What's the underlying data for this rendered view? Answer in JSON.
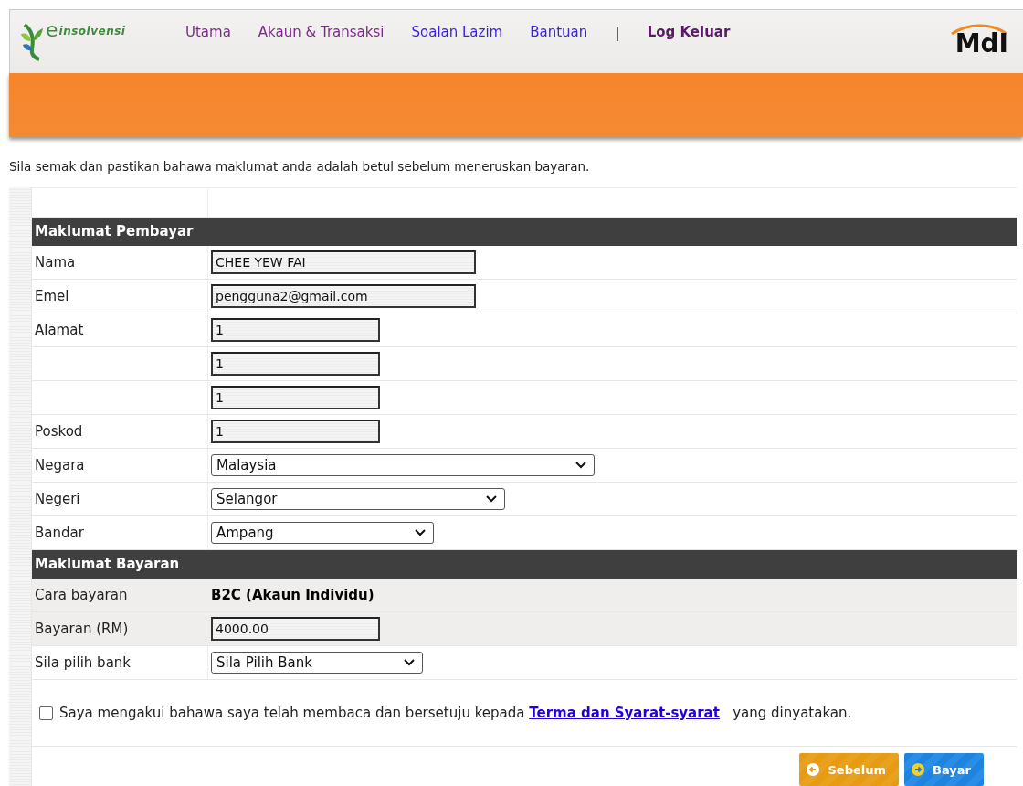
{
  "header": {
    "logo": {
      "letter": "e",
      "name": "insolvensi"
    },
    "nav": [
      {
        "label": "Utama",
        "color": "#7a2a8a",
        "bold": false
      },
      {
        "label": "Akaun & Transaksi",
        "color": "#7a2a8a",
        "bold": false
      },
      {
        "label": "Soalan Lazim",
        "color": "#3a22e0",
        "bold": false
      },
      {
        "label": "Bantuan",
        "color": "#3a22e0",
        "bold": false
      },
      {
        "label": "|",
        "kind": "separator"
      },
      {
        "label": "Log Keluar",
        "color": "#5a1a6a",
        "bold": true
      }
    ],
    "brand": "MdI"
  },
  "intro": "Sila semak dan pastikan bahawa maklumat anda adalah betul sebelum meneruskan bayaran.",
  "sections": [
    {
      "title": "Maklumat Pembayar",
      "rows": [
        {
          "label": "Nama",
          "kind": "input",
          "value": "CHEE YEW FAI",
          "shaded": false
        },
        {
          "label": "Emel",
          "kind": "input",
          "value": "pengguna2@gmail.com",
          "shaded": false
        },
        {
          "label": "Alamat",
          "kind": "input",
          "value": "1",
          "shaded": false
        },
        {
          "kind": "input",
          "value": "1",
          "shaded": false
        },
        {
          "kind": "input",
          "value": "1",
          "shaded": false
        },
        {
          "label": "Poskod",
          "kind": "input",
          "value": "1",
          "shaded": false
        },
        {
          "label": "Negara",
          "kind": "select",
          "value": "Malaysia",
          "shaded": false
        },
        {
          "label": "Negeri",
          "kind": "select",
          "value": "Selangor",
          "shaded": false
        },
        {
          "label": "Bandar",
          "kind": "select",
          "value": "Ampang",
          "shaded": false
        }
      ]
    },
    {
      "title": "Maklumat Bayaran",
      "rows": [
        {
          "label": "Cara bayaran",
          "kind": "text",
          "value": "B2C (Akaun Individu)",
          "shaded": true
        },
        {
          "label": "Bayaran (RM)",
          "kind": "input",
          "value": "4000.00",
          "shaded": true
        },
        {
          "label": "Sila pilih bank",
          "kind": "select",
          "value": "Sila Pilih Bank",
          "shaded": false
        }
      ]
    }
  ],
  "agreement": {
    "checked": false,
    "before": "Saya mengakui bahawa saya telah membaca dan bersetuju kepada",
    "link": "Terma dan Syarat-syarat",
    "after": "yang dinyatakan."
  },
  "buttons": [
    {
      "label": "Sebelum",
      "kind": "back"
    },
    {
      "label": "Bayar",
      "kind": "next"
    }
  ]
}
